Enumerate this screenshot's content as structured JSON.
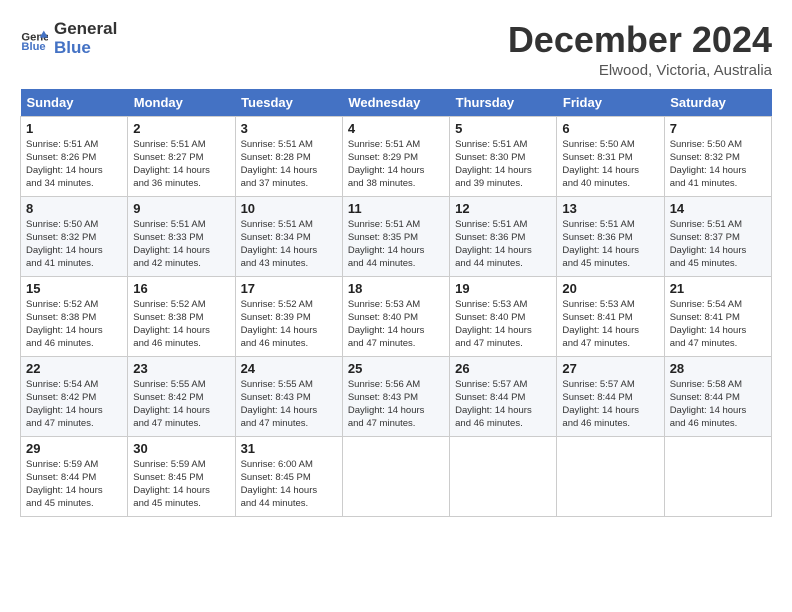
{
  "logo": {
    "line1": "General",
    "line2": "Blue"
  },
  "title": "December 2024",
  "location": "Elwood, Victoria, Australia",
  "header": {
    "days": [
      "Sunday",
      "Monday",
      "Tuesday",
      "Wednesday",
      "Thursday",
      "Friday",
      "Saturday"
    ]
  },
  "weeks": [
    [
      {
        "day": "1",
        "sunrise": "5:51 AM",
        "sunset": "8:26 PM",
        "daylight": "14 hours and 34 minutes."
      },
      {
        "day": "2",
        "sunrise": "5:51 AM",
        "sunset": "8:27 PM",
        "daylight": "14 hours and 36 minutes."
      },
      {
        "day": "3",
        "sunrise": "5:51 AM",
        "sunset": "8:28 PM",
        "daylight": "14 hours and 37 minutes."
      },
      {
        "day": "4",
        "sunrise": "5:51 AM",
        "sunset": "8:29 PM",
        "daylight": "14 hours and 38 minutes."
      },
      {
        "day": "5",
        "sunrise": "5:51 AM",
        "sunset": "8:30 PM",
        "daylight": "14 hours and 39 minutes."
      },
      {
        "day": "6",
        "sunrise": "5:50 AM",
        "sunset": "8:31 PM",
        "daylight": "14 hours and 40 minutes."
      },
      {
        "day": "7",
        "sunrise": "5:50 AM",
        "sunset": "8:32 PM",
        "daylight": "14 hours and 41 minutes."
      }
    ],
    [
      {
        "day": "8",
        "sunrise": "5:50 AM",
        "sunset": "8:32 PM",
        "daylight": "14 hours and 41 minutes."
      },
      {
        "day": "9",
        "sunrise": "5:51 AM",
        "sunset": "8:33 PM",
        "daylight": "14 hours and 42 minutes."
      },
      {
        "day": "10",
        "sunrise": "5:51 AM",
        "sunset": "8:34 PM",
        "daylight": "14 hours and 43 minutes."
      },
      {
        "day": "11",
        "sunrise": "5:51 AM",
        "sunset": "8:35 PM",
        "daylight": "14 hours and 44 minutes."
      },
      {
        "day": "12",
        "sunrise": "5:51 AM",
        "sunset": "8:36 PM",
        "daylight": "14 hours and 44 minutes."
      },
      {
        "day": "13",
        "sunrise": "5:51 AM",
        "sunset": "8:36 PM",
        "daylight": "14 hours and 45 minutes."
      },
      {
        "day": "14",
        "sunrise": "5:51 AM",
        "sunset": "8:37 PM",
        "daylight": "14 hours and 45 minutes."
      }
    ],
    [
      {
        "day": "15",
        "sunrise": "5:52 AM",
        "sunset": "8:38 PM",
        "daylight": "14 hours and 46 minutes."
      },
      {
        "day": "16",
        "sunrise": "5:52 AM",
        "sunset": "8:38 PM",
        "daylight": "14 hours and 46 minutes."
      },
      {
        "day": "17",
        "sunrise": "5:52 AM",
        "sunset": "8:39 PM",
        "daylight": "14 hours and 46 minutes."
      },
      {
        "day": "18",
        "sunrise": "5:53 AM",
        "sunset": "8:40 PM",
        "daylight": "14 hours and 47 minutes."
      },
      {
        "day": "19",
        "sunrise": "5:53 AM",
        "sunset": "8:40 PM",
        "daylight": "14 hours and 47 minutes."
      },
      {
        "day": "20",
        "sunrise": "5:53 AM",
        "sunset": "8:41 PM",
        "daylight": "14 hours and 47 minutes."
      },
      {
        "day": "21",
        "sunrise": "5:54 AM",
        "sunset": "8:41 PM",
        "daylight": "14 hours and 47 minutes."
      }
    ],
    [
      {
        "day": "22",
        "sunrise": "5:54 AM",
        "sunset": "8:42 PM",
        "daylight": "14 hours and 47 minutes."
      },
      {
        "day": "23",
        "sunrise": "5:55 AM",
        "sunset": "8:42 PM",
        "daylight": "14 hours and 47 minutes."
      },
      {
        "day": "24",
        "sunrise": "5:55 AM",
        "sunset": "8:43 PM",
        "daylight": "14 hours and 47 minutes."
      },
      {
        "day": "25",
        "sunrise": "5:56 AM",
        "sunset": "8:43 PM",
        "daylight": "14 hours and 47 minutes."
      },
      {
        "day": "26",
        "sunrise": "5:57 AM",
        "sunset": "8:44 PM",
        "daylight": "14 hours and 46 minutes."
      },
      {
        "day": "27",
        "sunrise": "5:57 AM",
        "sunset": "8:44 PM",
        "daylight": "14 hours and 46 minutes."
      },
      {
        "day": "28",
        "sunrise": "5:58 AM",
        "sunset": "8:44 PM",
        "daylight": "14 hours and 46 minutes."
      }
    ],
    [
      {
        "day": "29",
        "sunrise": "5:59 AM",
        "sunset": "8:44 PM",
        "daylight": "14 hours and 45 minutes."
      },
      {
        "day": "30",
        "sunrise": "5:59 AM",
        "sunset": "8:45 PM",
        "daylight": "14 hours and 45 minutes."
      },
      {
        "day": "31",
        "sunrise": "6:00 AM",
        "sunset": "8:45 PM",
        "daylight": "14 hours and 44 minutes."
      },
      null,
      null,
      null,
      null
    ]
  ],
  "labels": {
    "sunrise": "Sunrise:",
    "sunset": "Sunset:",
    "daylight": "Daylight:"
  }
}
